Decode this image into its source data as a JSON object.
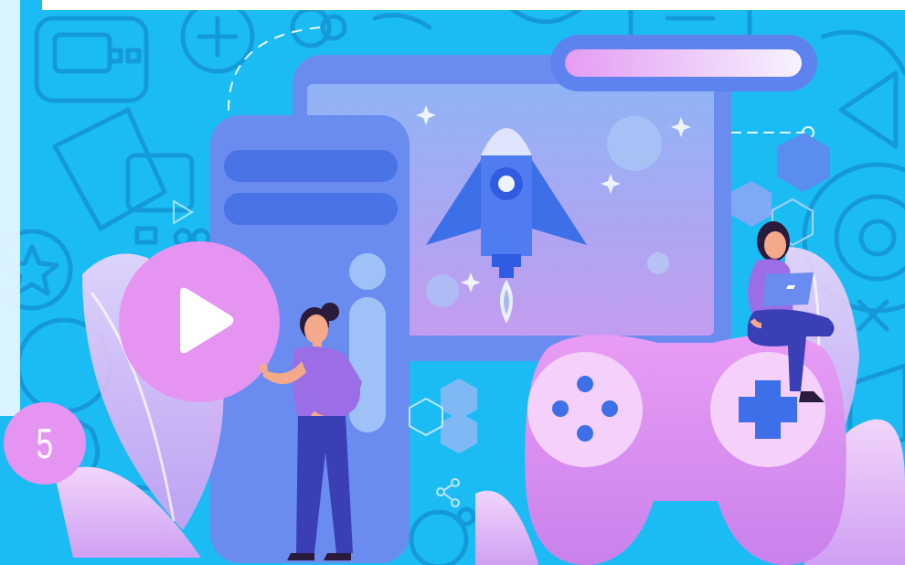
{
  "badge": {
    "step_number": "5"
  },
  "colors": {
    "background": "#1bbcf4",
    "pattern_line": "#159ad9",
    "monitor_frame": "#6a8cf0",
    "screen_gradient_top": "#8fb4f5",
    "screen_gradient_bottom": "#c69bf0",
    "accent_pink": "#e594f2",
    "rocket_blue": "#3d6fe8",
    "character_purple": "#9b6ee8",
    "character_pants": "#3a3fb5"
  },
  "icons": [
    "play-icon",
    "rocket-icon",
    "gamepad-icon",
    "laptop-icon",
    "sparkle-icon",
    "hexagon-icon",
    "share-icon"
  ]
}
